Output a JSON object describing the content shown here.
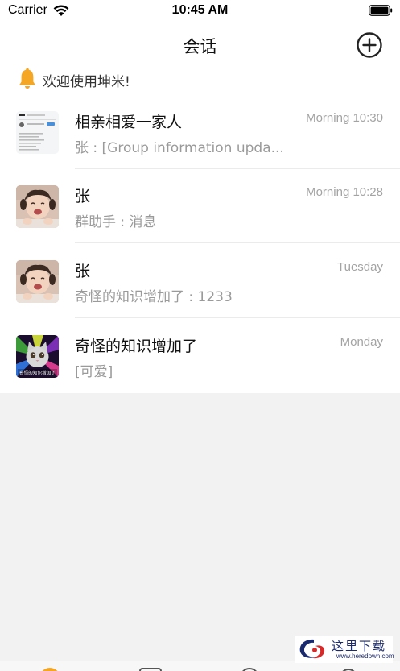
{
  "status_bar": {
    "carrier": "Carrier",
    "time": "10:45 AM"
  },
  "nav": {
    "title": "会话",
    "add_icon": "plus-circle-icon"
  },
  "notice": {
    "icon": "bell-icon",
    "text": "欢迎使用坤米!"
  },
  "conversations": [
    {
      "name": "相亲相爱一家人",
      "preview": "张 : [Group information upda...",
      "time": "Morning 10:30",
      "avatar": "group-avatar"
    },
    {
      "name": "张",
      "preview": "群助手 : 消息",
      "time": "Morning 10:28",
      "avatar": "child-photo-avatar"
    },
    {
      "name": "张",
      "preview": "奇怪的知识增加了 : 1233",
      "time": "Tuesday",
      "avatar": "child-photo-avatar"
    },
    {
      "name": "奇怪的知识增加了",
      "preview": "[可爱]",
      "time": "Monday",
      "avatar": "cat-meme-avatar",
      "avatar_caption": "奇怪的知识增加了"
    }
  ],
  "watermark": {
    "text": "这里下载",
    "url": "www.heredown.com"
  },
  "colors": {
    "accent": "#f5a623",
    "background": "#f2f2f2",
    "secondary_text": "#9a9a9a"
  }
}
